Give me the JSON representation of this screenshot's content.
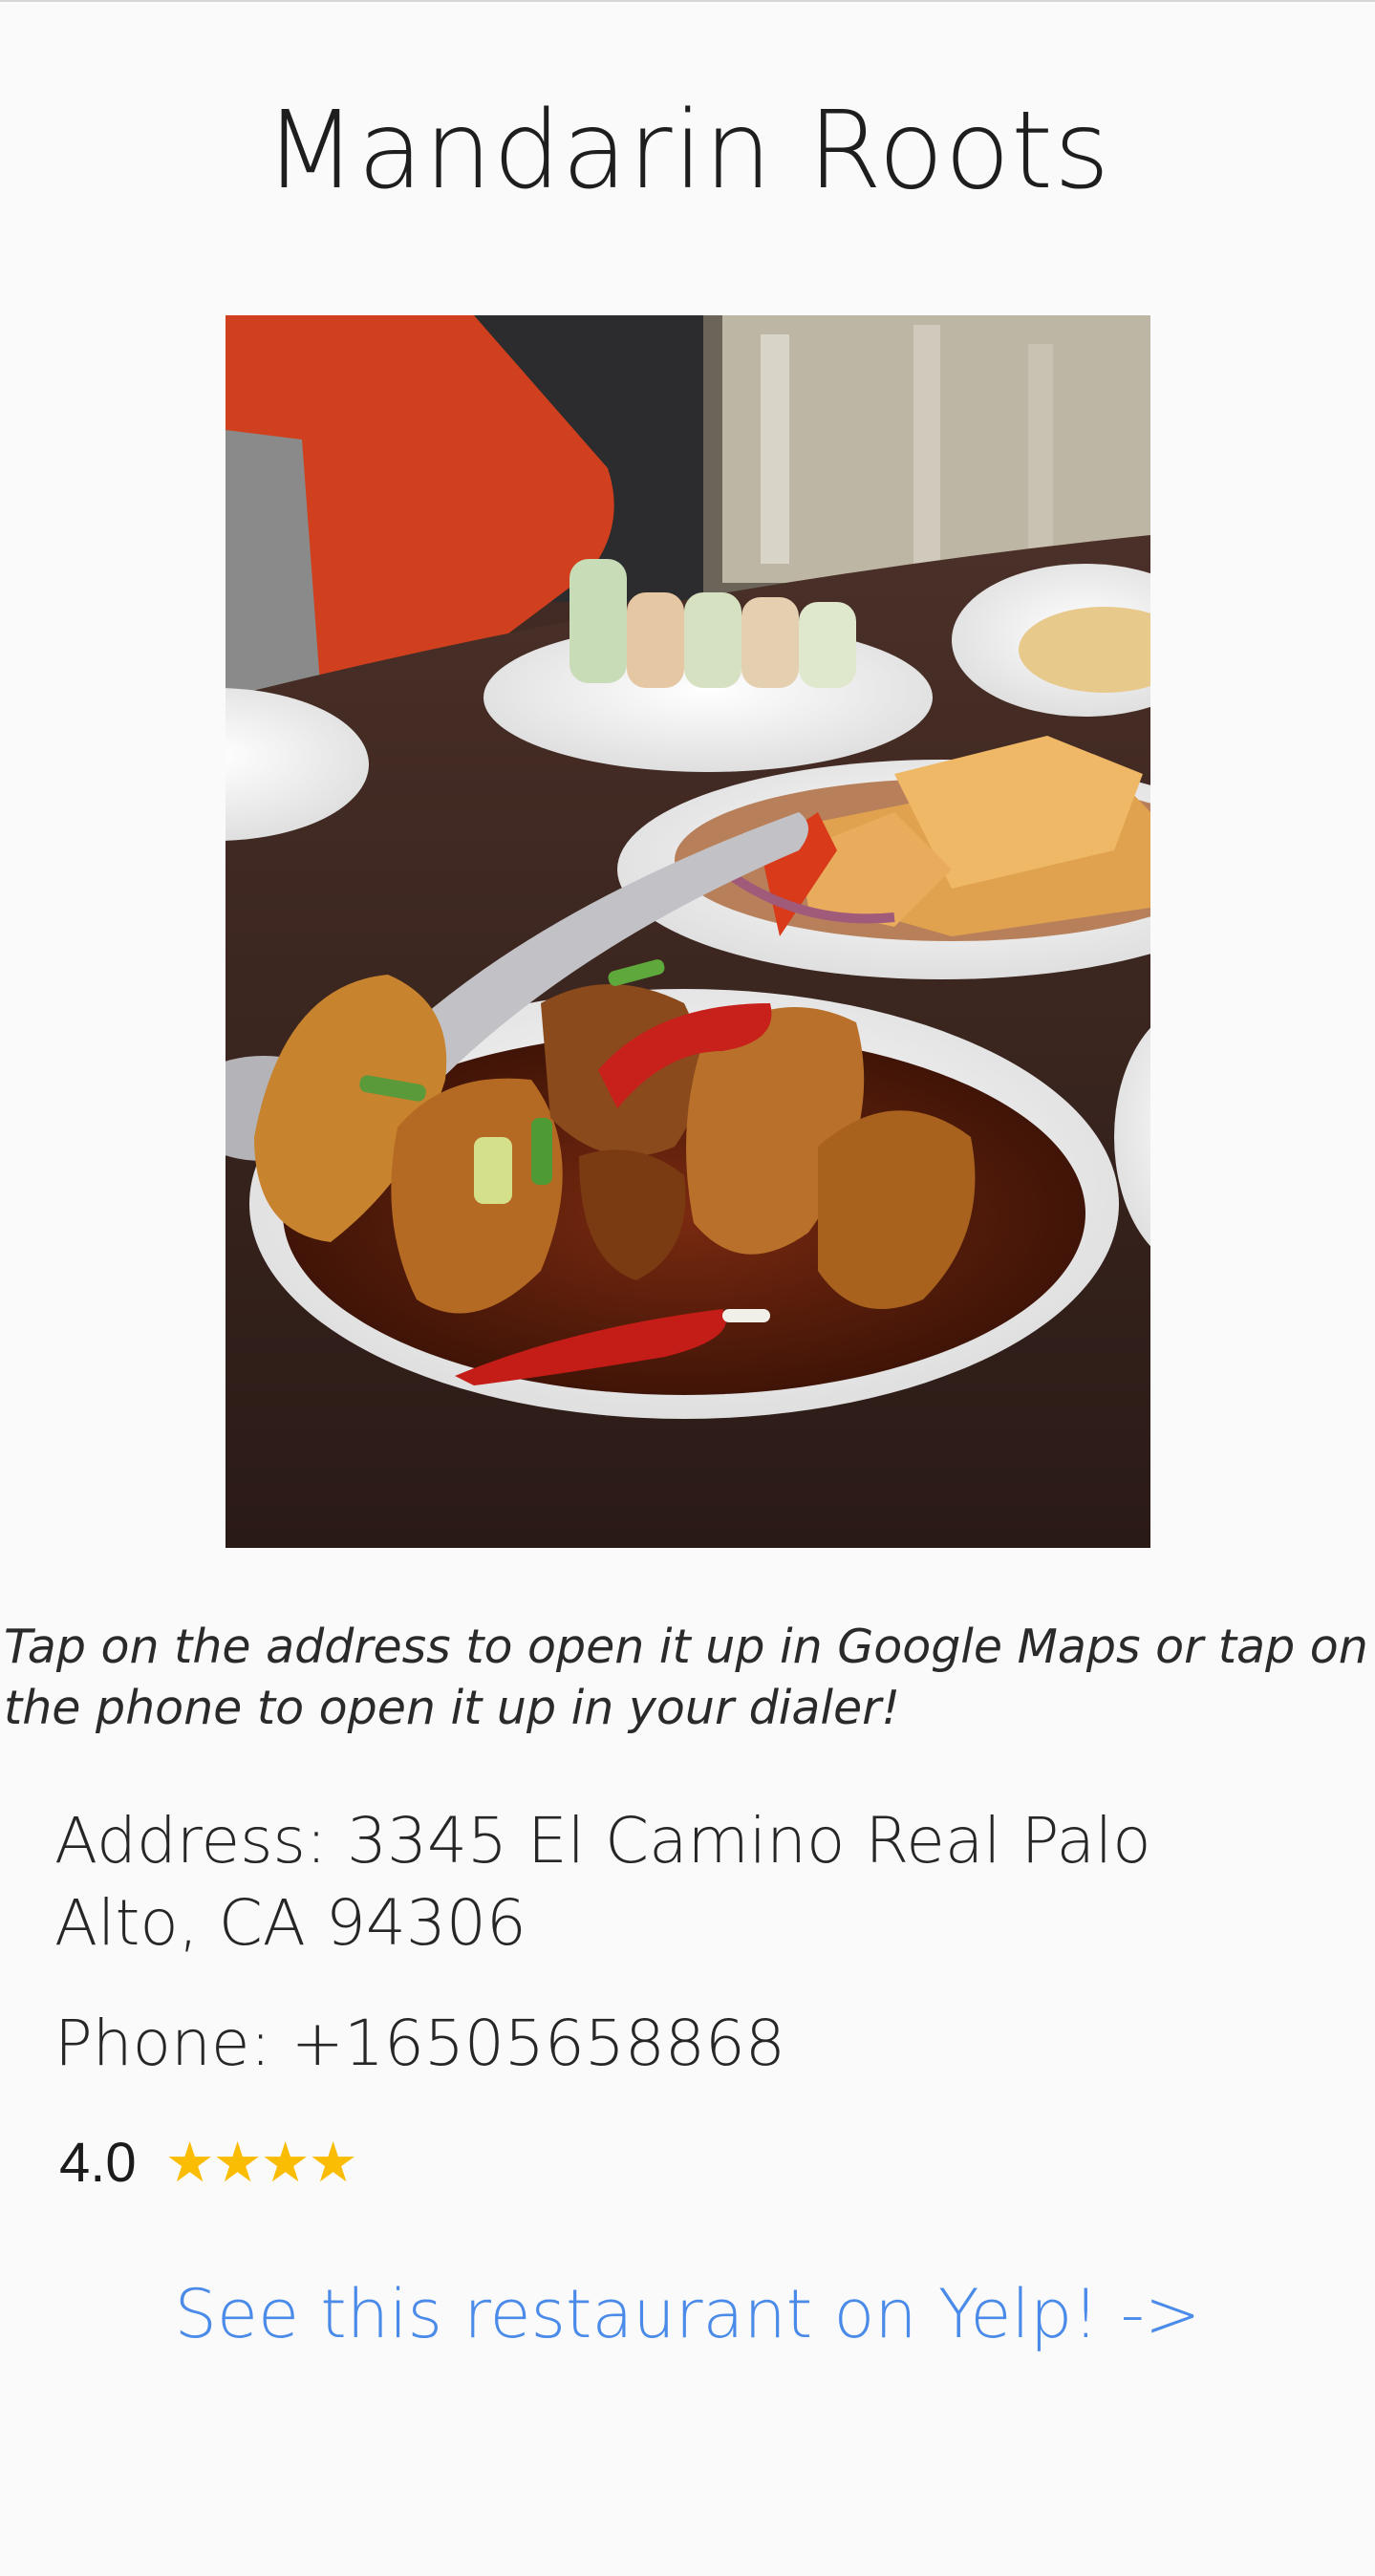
{
  "restaurant": {
    "name": "Mandarin Roots",
    "hint": "Tap on the address to open it up in Google Maps or tap on the phone to open it up in your dialer!",
    "address": "Address: 3345 El Camino Real Palo Alto, CA 94306",
    "phone": "Phone: +16505658868",
    "rating": "4.0",
    "rating_stars": 4,
    "yelp_link": "See this restaurant on Yelp! ->"
  },
  "colors": {
    "background": "#fafafa",
    "link": "#4a8ae8",
    "star": "#fbbc04",
    "text": "#262626"
  },
  "icons": {
    "star": "star-icon"
  }
}
